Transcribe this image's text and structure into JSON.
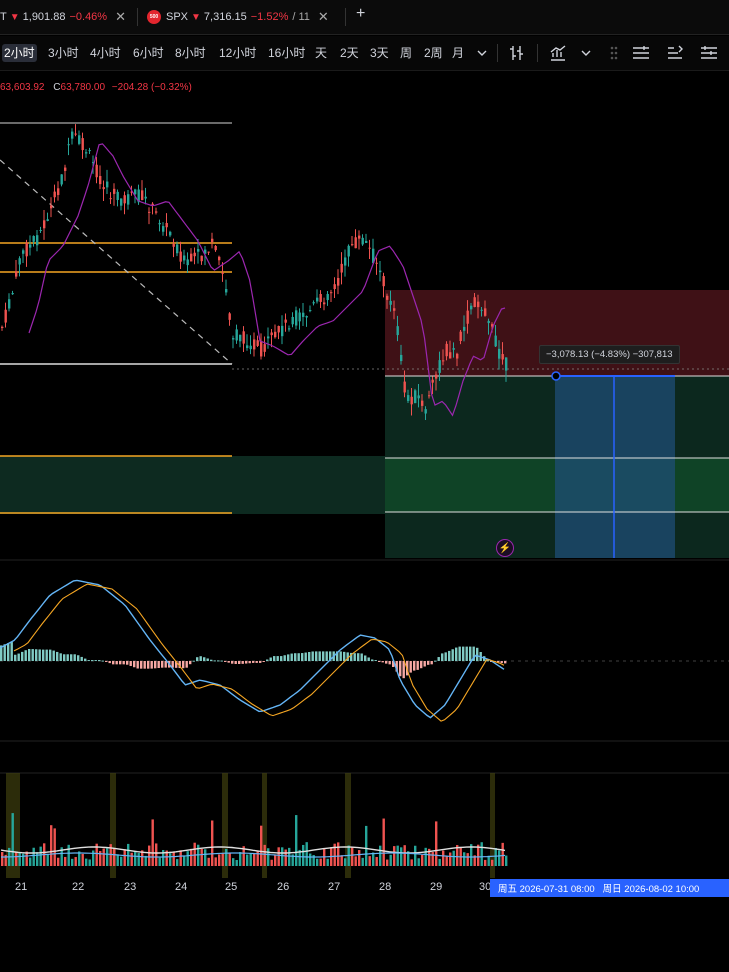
{
  "tabs": [
    {
      "symbol": "T",
      "price": "1,901.88",
      "change": "−0.46%"
    },
    {
      "symbol": "SPX",
      "logo": "500",
      "price": "7,316.15",
      "change": "−1.52%",
      "extra": "/ 11"
    }
  ],
  "new_tab_label": "+",
  "timeframes": [
    "2小时",
    "3小时",
    "4小时",
    "6小时",
    "8小时",
    "12小时",
    "16小时",
    "天",
    "2天",
    "3天",
    "周",
    "2周",
    "月"
  ],
  "active_timeframe_index": 0,
  "toolbar_icons": [
    "chevron-down-icon",
    "bar-style-icon",
    "indicators-icon",
    "chevron-down-icon",
    "drag-handle-icon",
    "alert-list-icon",
    "replay-icon",
    "layout-icon"
  ],
  "ohlc": {
    "close_val": "63,603.92",
    "mark": "C",
    "h_val": "63,780.00",
    "change": "−204.28 (−0.32%)"
  },
  "position_label": "−3,078.13 (−4.83%) −307,813",
  "colors": {
    "up": "#26a69a",
    "down": "#ef5350",
    "accent": "#2962ff",
    "orange": "#f5a623",
    "ma": "#9c27b0"
  },
  "chart_data": {
    "type": "candlestick",
    "x_ticks": [
      "21",
      "22",
      "23",
      "24",
      "25",
      "26",
      "27",
      "28",
      "29",
      "30"
    ],
    "crosshair_label": {
      "start": "周五 2026-07-31  08:00",
      "end": "周日 2026-08-02  10:00"
    },
    "indicators": [
      "MACD",
      "Volume"
    ]
  },
  "bolt_icon": "lightning-icon"
}
